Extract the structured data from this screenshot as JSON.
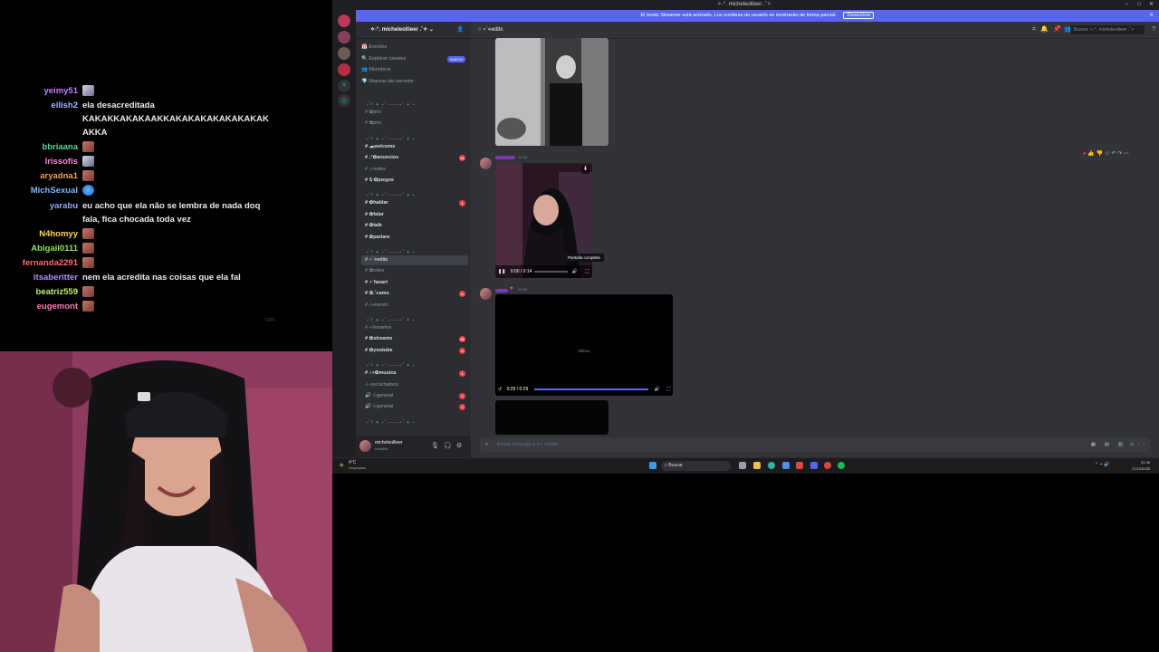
{
  "chat": {
    "messages": [
      {
        "user": "yeimy51",
        "color": "#c77dff",
        "text": "",
        "emotes": [
          "alt"
        ]
      },
      {
        "user": "eilish2",
        "color": "#a7b6ff",
        "text": "ela desacreditada KAKAKKAKAKAAKKAKAKAKAKAKAKAKAK AKKA",
        "emotes": []
      },
      {
        "user": "bbriaana",
        "color": "#5ad3a0",
        "text": "",
        "emotes": [
          "red"
        ]
      },
      {
        "user": "lrissofis",
        "color": "#ff8ad8",
        "text": "",
        "emotes": [
          "alt"
        ]
      },
      {
        "user": "aryadna1",
        "color": "#f0a058",
        "text": "",
        "emotes": [
          "red"
        ]
      },
      {
        "user": "MichSexual",
        "color": "#76b8ff",
        "text": "",
        "emotes": [
          "blue"
        ]
      },
      {
        "user": "yarabu",
        "color": "#9aa3ff",
        "text": "eu acho que ela não se lembra de nada doq fala, fica chocada toda vez",
        "emotes": []
      },
      {
        "user": "N4homyy",
        "color": "#ffd35a",
        "text": "",
        "emotes": [
          "red"
        ]
      },
      {
        "user": "Abigail0111",
        "color": "#8ee05a",
        "text": "",
        "emotes": [
          "red"
        ]
      },
      {
        "user": "fernanda2291",
        "color": "#ff6b6b",
        "text": "",
        "emotes": [
          "red"
        ]
      },
      {
        "user": "itsaberitter",
        "color": "#b88cff",
        "text": "nem ela acredita nas coisas que ela fal",
        "emotes": []
      },
      {
        "user": "beatriz559",
        "color": "#c3f06b",
        "text": "",
        "emotes": [
          "red"
        ]
      },
      {
        "user": "eugemont",
        "color": "#ff7ab6",
        "text": "",
        "emotes": [
          "red"
        ]
      }
    ],
    "watermark": "taix"
  },
  "discord": {
    "window_title": "✧˖°. micheleollieer .˚✧",
    "banner_text": "El modo Streamer está activado. Los nombres de usuario se mostrarán de forma parcial.",
    "banner_button": "Desactivar",
    "server_name": "✧˖°. micheleollieer .˚✧",
    "top_items": [
      {
        "label": "Eventos",
        "badge": ""
      },
      {
        "label": "Explorar canales",
        "badge": "NUEVO"
      },
      {
        "label": "Miembros",
        "badge": ""
      },
      {
        "label": "Mejoras del servidor",
        "badge": ""
      }
    ],
    "channels": [
      {
        "type": "cat",
        "label": "⋆˚࿔ ✦ ⋆˚ ───⋆˚ ✦ ⋆"
      },
      {
        "type": "ch",
        "label": "# ✿priv",
        "badge": ""
      },
      {
        "type": "ch",
        "label": "# ✿priv",
        "badge": ""
      },
      {
        "type": "cat",
        "label": "⋆˚࿔ ✦ ⋆˚ ───⋆˚ ✦ ⋆"
      },
      {
        "type": "ch",
        "label": "# ☁welcome",
        "badge": "",
        "bold": true
      },
      {
        "type": "ch",
        "label": "# .ᐟ✿anuncios",
        "badge": "21",
        "bold": true
      },
      {
        "type": "ch",
        "label": "# ⊹redes",
        "badge": ""
      },
      {
        "type": "ch",
        "label": "# ༉‧✿juegos",
        "badge": "",
        "bold": true
      },
      {
        "type": "cat",
        "label": "⋆˚࿔ ✦ ⋆˚ ───⋆˚ ✦ ⋆"
      },
      {
        "type": "ch",
        "label": "# ✿hablar",
        "badge": "1",
        "bold": true
      },
      {
        "type": "ch",
        "label": "# ✿falar",
        "badge": "",
        "bold": true
      },
      {
        "type": "ch",
        "label": "# ✿talk",
        "badge": "",
        "bold": true
      },
      {
        "type": "ch",
        "label": "# ✿parlare",
        "badge": "",
        "bold": true
      },
      {
        "type": "cat",
        "label": "⋆˚࿔ ✦ ⋆˚ ───⋆˚ ✦ ⋆"
      },
      {
        "type": "ch",
        "label": "# ⋆˙⟡edits",
        "badge": "",
        "active": true
      },
      {
        "type": "ch",
        "label": "# ✿roles",
        "badge": ""
      },
      {
        "type": "ch",
        "label": "# ⋆˙fanart",
        "badge": "",
        "bold": true
      },
      {
        "type": "ch",
        "label": "# ✿.˚cams",
        "badge": "6",
        "bold": true
      },
      {
        "type": "ch",
        "label": "# ⊹evento",
        "badge": ""
      },
      {
        "type": "cat",
        "label": "⋆˚࿔ ✦ ⋆˚ ───⋆˚ ✦ ⋆"
      },
      {
        "type": "ch",
        "label": "# ⊹horarios",
        "badge": ""
      },
      {
        "type": "ch",
        "label": "# ✿streams",
        "badge": "25",
        "bold": true
      },
      {
        "type": "ch",
        "label": "# ✿youtube",
        "badge": "3",
        "bold": true
      },
      {
        "type": "cat",
        "label": "⋆˚࿔ ✦ ⋆˚ ───⋆˚ ✦ ⋆"
      },
      {
        "type": "ch",
        "label": "# ♪⋆✿musica",
        "badge": "1",
        "bold": true
      },
      {
        "type": "ch",
        "label": "⊹ escuchamos",
        "badge": ""
      },
      {
        "type": "ch",
        "label": "🔊 ⊹general",
        "badge": "3"
      },
      {
        "type": "ch",
        "label": "🔊 ⊹general",
        "badge": "3"
      },
      {
        "type": "cat",
        "label": "⋆˚࿔ ✦ ⋆˚ ───⋆˚ ✦ ⋆"
      }
    ],
    "user_name": "micheleollieer",
    "user_status": "Invisible",
    "channel_header": "⋆˙⟡edits",
    "search_placeholder": "Buscar ✧˖°. micheleollieer .˚✧",
    "messages": [
      {
        "time": "12:40",
        "video": {
          "time": "0:00 / 0:14",
          "tooltip": "Pantalla completa"
        }
      },
      {
        "time": "12:42",
        "video": {
          "time": "0:29 / 0:29",
          "center": "tokbus"
        }
      }
    ],
    "input_placeholder": "Enviar mensaje a #⋆˙⟡edits"
  },
  "taskbar": {
    "weather_temp": "4°C",
    "weather_desc": "Despejado",
    "search": "Buscar",
    "time": "22:36",
    "date": "27/12/2025"
  }
}
